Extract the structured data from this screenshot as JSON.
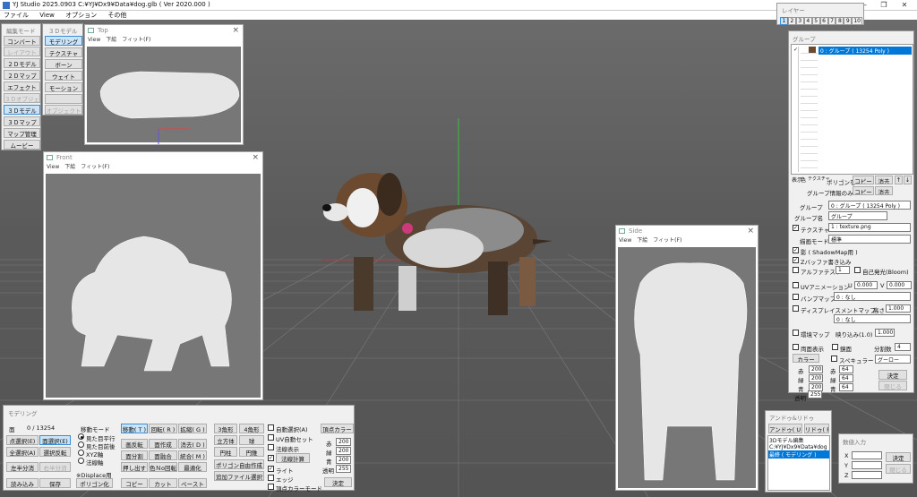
{
  "app": {
    "title": "YJ Studio 2025.0903   C:¥YJ¥Dx9¥Data¥dog.glb ( Ver 2020.000 )",
    "menu": [
      "ファイル",
      "View",
      "オプション",
      "その他"
    ]
  },
  "window_controls": {
    "min": "—",
    "max": "❐",
    "close": "✕"
  },
  "layer": {
    "title": "レイヤー",
    "tabs": [
      "1",
      "2",
      "3",
      "4",
      "5",
      "6",
      "7",
      "8",
      "9",
      "10"
    ]
  },
  "edit_mode": {
    "title": "編集モード",
    "items": [
      {
        "label": "コンバート"
      },
      {
        "label": "レイアウト",
        "disabled": true
      },
      {
        "label": "２Ｄモデル"
      },
      {
        "label": "２Ｄマップ"
      },
      {
        "label": "エフェクト"
      },
      {
        "label": "３Ｄオブジェクト",
        "disabled": true
      },
      {
        "label": "３Ｄモデル",
        "selected": true
      },
      {
        "label": "３Ｄマップ"
      },
      {
        "label": "マップ管理"
      },
      {
        "label": "ムービー"
      }
    ]
  },
  "model3d": {
    "title": "３Ｄモデル",
    "items": [
      {
        "label": "モデリング",
        "selected": true
      },
      {
        "label": "テクスチャ"
      },
      {
        "label": "ボーン"
      },
      {
        "label": "ウェイト"
      },
      {
        "label": "モーション"
      },
      {
        "label": "",
        "disabled": true
      },
      {
        "label": "オブジェクト",
        "disabled": true
      }
    ]
  },
  "views": {
    "menu": [
      "View",
      "下絵",
      "フィット(F)"
    ],
    "top": "Top",
    "front": "Front",
    "side": "Side"
  },
  "group": {
    "title": "グループ",
    "item": "0 : グループ ( 13254 Poly )",
    "tabs": [
      "表示",
      "色",
      "テクスチャ"
    ],
    "poly_label": "ポリゴンを",
    "group_info_label": "グループ情報のみ",
    "copy": "コピー",
    "delete": "消去",
    "up": "↑",
    "down": "↓",
    "group_label": "グループ",
    "group_select": "0 : グループ ( 13254 Poly )",
    "group_name_label": "グループ名",
    "group_name": "グループ",
    "texture_label": "テクスチャ",
    "texture_value": "1 : texture.png",
    "draw_mode_label": "描画モード",
    "draw_mode": "標準",
    "shadow": "影 ( ShadowMap用 )",
    "zbuffer": "Zバッファ書き込み",
    "alpha_test": "アルファテスト",
    "alpha_value": "1",
    "self_light": "自己発光(Bloom)",
    "uv_anim": "UVアニメーション",
    "u_label": "U",
    "u_value": "0.000",
    "v_label": "V",
    "v_value": "0.000",
    "bump": "バンプマップ",
    "bump_value": "0 : なし",
    "displace": "ディスプレイスメントマップ",
    "height_label": "高さ",
    "height_value": "1.000",
    "displace_value": "0 : なし",
    "env": "環境マップ",
    "reflect_label": "映り込み(1.0)",
    "reflect_value": "1.000",
    "both": "両面表示",
    "mirror": "鏡面",
    "split_label": "分割数",
    "split_value": "4",
    "color_btn": "カラー",
    "specular": "スペキュラー",
    "gloss": "グーロー",
    "red_label": "赤",
    "green_label": "緑",
    "blue_label": "青",
    "alpha_label": "透明",
    "r1": "200",
    "g1": "200",
    "b1": "200",
    "a1": "255",
    "r2": "64",
    "g2": "64",
    "b2": "64",
    "ok": "決定",
    "close": "閉じる"
  },
  "undo": {
    "title": "アンドゥ&リドゥ",
    "undo": "アンドゥ( U )",
    "redo": "リドゥ( R )",
    "items": [
      "3Dモデル編集",
      "C:¥YJ¥Dx9¥Data¥dog",
      "最終 ( モデリング )"
    ]
  },
  "numinput": {
    "title": "数値入力",
    "x": "X",
    "y": "Y",
    "z": "Z",
    "ok": "決定",
    "close": "閉じる"
  },
  "modeling": {
    "title": "モデリング",
    "face_label": "面",
    "face_value": "0 / 13254",
    "buttons_left": [
      "点選択(E)",
      "面選択(E)",
      "全選択(A)",
      "選択反転",
      "左半分消",
      "右半分消",
      "読み込み",
      "保存"
    ],
    "move_mode": "移動モード",
    "radios": [
      "見た目平行",
      "見た目前後",
      "XYZ軸",
      "法線軸"
    ],
    "displace_note": "※Displace用",
    "polyize": "ポリゴン化",
    "mid": [
      "移動( T )",
      "回転( R )",
      "拡縮( G )",
      "画反転",
      "面作成",
      "消去( D )",
      "面分割",
      "面融合",
      "統合( M )",
      "押し出す",
      "色Ｎo回転",
      "最適化",
      "コピー",
      "カット",
      "ペースト"
    ],
    "shape": [
      "3角形",
      "4角形",
      "立方体",
      "球",
      "円柱",
      "円錐"
    ],
    "poly_edit": "ポリゴン自由作成",
    "add_file": "追加ファイル選択",
    "checks": [
      "自動選択(A)",
      "UV自動セット",
      "法線表示",
      "法線計算",
      "ライト",
      "エッジ",
      "頂点カラーモード"
    ],
    "vertex_color": "頂点カラー",
    "vc_r": "赤",
    "vc_g": "緑",
    "vc_b": "青",
    "vc_a": "透明",
    "vr": "200",
    "vg": "200",
    "vb": "200",
    "va": "255",
    "ok": "決定"
  }
}
